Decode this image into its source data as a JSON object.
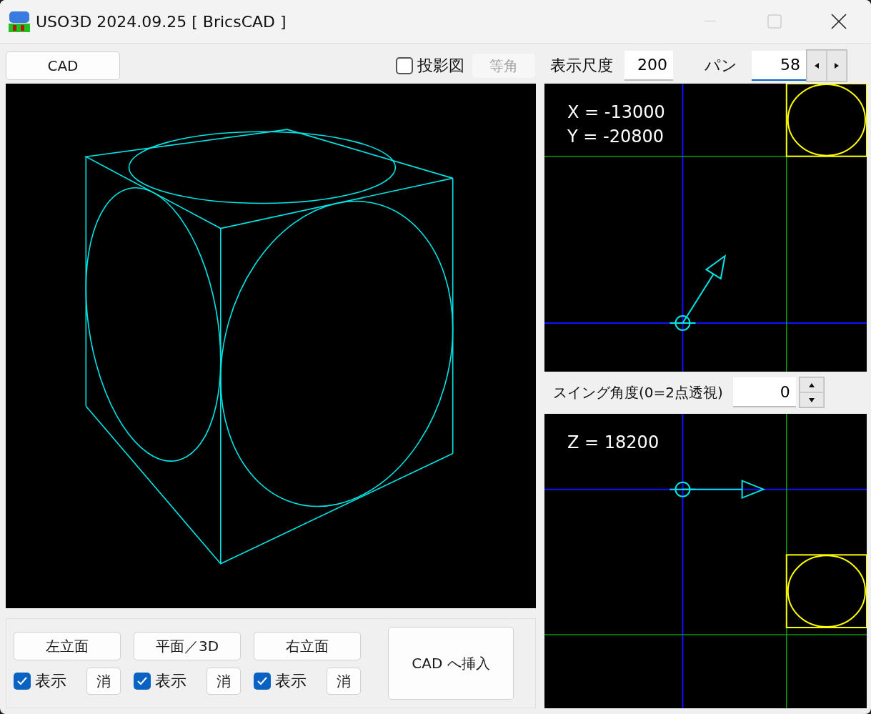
{
  "window": {
    "title": "USO3D 2024.09.25 [ BricsCAD ]"
  },
  "toolbar": {
    "cad_button": "CAD",
    "projection": {
      "label": "投影図",
      "checked": false
    },
    "isometric": {
      "label": "等角",
      "disabled": true
    }
  },
  "scale": {
    "label": "表示尺度",
    "value": "200"
  },
  "pan": {
    "label": "パン",
    "value": "58"
  },
  "top_view": {
    "x_reading": "X = -13000",
    "y_reading": "Y = -20800"
  },
  "swing": {
    "label": "スイング角度(0=2点透視)",
    "value": "0"
  },
  "side_view": {
    "z_reading": "Z = 18200"
  },
  "views": [
    {
      "label": "左立面",
      "show": {
        "label": "表示",
        "checked": true
      },
      "clear": "消"
    },
    {
      "label": "平面／3D",
      "show": {
        "label": "表示",
        "checked": true
      },
      "clear": "消"
    },
    {
      "label": "右立面",
      "show": {
        "label": "表示",
        "checked": true
      },
      "clear": "消"
    }
  ],
  "insert_button": "CAD へ挿入"
}
